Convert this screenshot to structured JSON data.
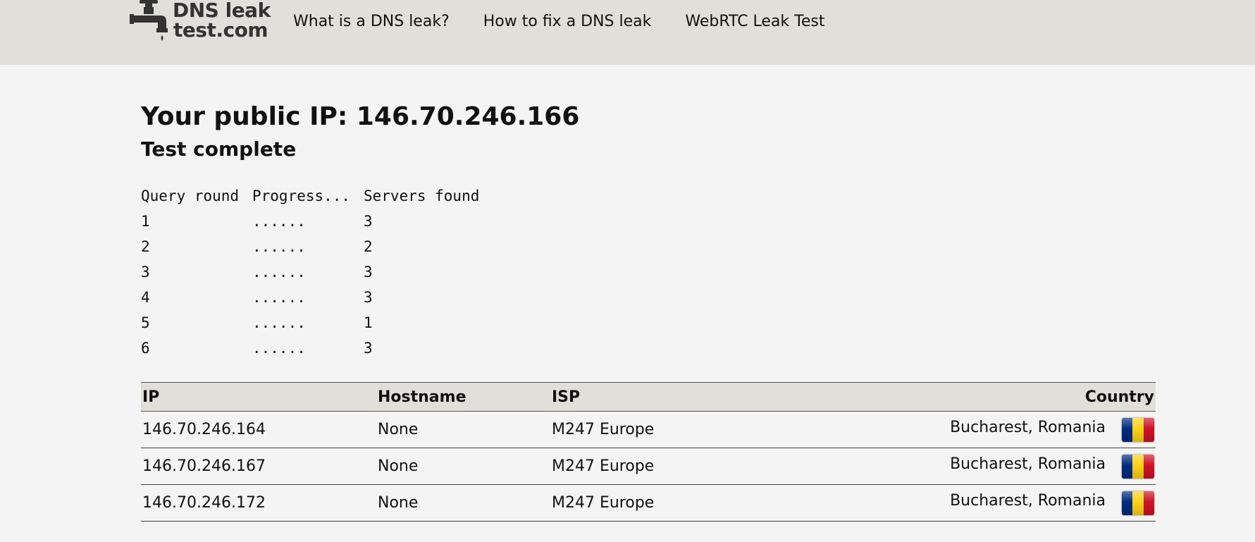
{
  "header": {
    "logo_line1": "DNS leak",
    "logo_line2": "test.com",
    "nav": [
      {
        "label": "What is a DNS leak?"
      },
      {
        "label": "How to fix a DNS leak"
      },
      {
        "label": "WebRTC Leak Test"
      }
    ]
  },
  "main": {
    "ip_title": "Your public IP: 146.70.246.166",
    "status": "Test complete",
    "rounds_header": [
      "Query round",
      "Progress...",
      "Servers found"
    ],
    "rounds": [
      {
        "round": "1",
        "progress": "......",
        "servers": "3"
      },
      {
        "round": "2",
        "progress": "......",
        "servers": "2"
      },
      {
        "round": "3",
        "progress": "......",
        "servers": "3"
      },
      {
        "round": "4",
        "progress": "......",
        "servers": "3"
      },
      {
        "round": "5",
        "progress": "......",
        "servers": "1"
      },
      {
        "round": "6",
        "progress": "......",
        "servers": "3"
      }
    ]
  },
  "table": {
    "headers": {
      "ip": "IP",
      "hostname": "Hostname",
      "isp": "ISP",
      "country": "Country"
    },
    "rows": [
      {
        "ip": "146.70.246.164",
        "hostname": "None",
        "isp": "M247 Europe",
        "country": "Bucharest, Romania",
        "flag": "romania-flag-icon"
      },
      {
        "ip": "146.70.246.167",
        "hostname": "None",
        "isp": "M247 Europe",
        "country": "Bucharest, Romania",
        "flag": "romania-flag-icon"
      },
      {
        "ip": "146.70.246.172",
        "hostname": "None",
        "isp": "M247 Europe",
        "country": "Bucharest, Romania",
        "flag": "romania-flag-icon"
      }
    ]
  },
  "colors": {
    "header_bg": "#e0dfda",
    "page_bg": "#f4f4f4",
    "flag_blue": "#002b7f",
    "flag_yellow": "#fcd116",
    "flag_red": "#ce1126"
  }
}
